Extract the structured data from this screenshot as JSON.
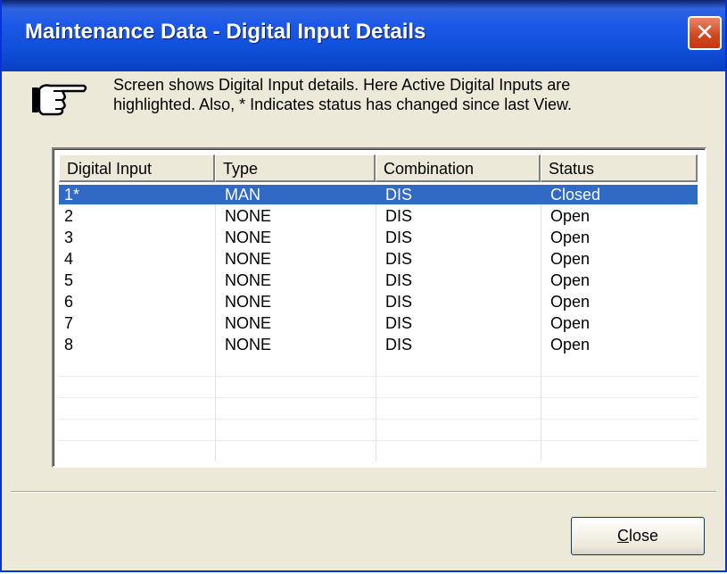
{
  "window": {
    "title": "Maintenance Data - Digital Input Details",
    "close_glyph": "✕"
  },
  "hint": {
    "icon": "pointing-hand-icon",
    "line1": "Screen shows Digital Input details. Here Active Digital Inputs are",
    "line2": "highlighted.  Also,  *  Indicates status has changed since last View."
  },
  "table": {
    "columns": [
      "Digital Input",
      "Type",
      "Combination",
      "Status"
    ],
    "rows": [
      {
        "input": "1*",
        "type": "MAN",
        "combination": "DIS",
        "status": "Closed",
        "selected": true
      },
      {
        "input": "2",
        "type": "NONE",
        "combination": "DIS",
        "status": "Open"
      },
      {
        "input": "3",
        "type": "NONE",
        "combination": "DIS",
        "status": "Open"
      },
      {
        "input": "4",
        "type": "NONE",
        "combination": "DIS",
        "status": "Open"
      },
      {
        "input": "5",
        "type": "NONE",
        "combination": "DIS",
        "status": "Open"
      },
      {
        "input": "6",
        "type": "NONE",
        "combination": "DIS",
        "status": "Open"
      },
      {
        "input": "7",
        "type": "NONE",
        "combination": "DIS",
        "status": "Open"
      },
      {
        "input": "8",
        "type": "NONE",
        "combination": "DIS",
        "status": "Open"
      }
    ]
  },
  "buttons": {
    "close_mnemonic": "C",
    "close_rest": "lose"
  },
  "colors": {
    "selection": "#316ac5",
    "titlebar": "#0f4fd8",
    "close_button": "#d0451b"
  }
}
